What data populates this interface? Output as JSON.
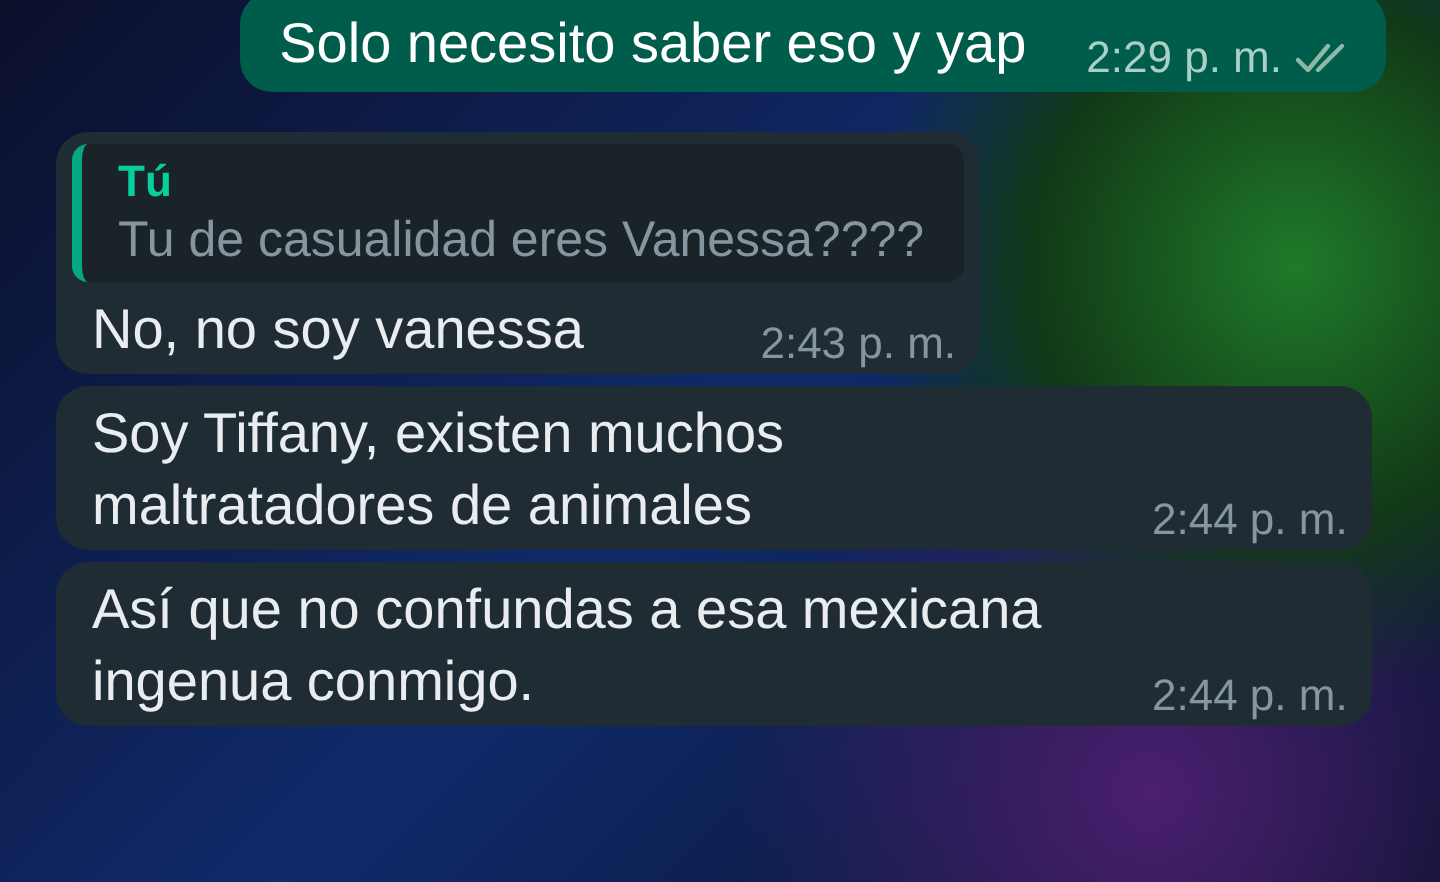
{
  "messages": [
    {
      "kind": "outgoing",
      "text": "Solo necesito saber eso y yap",
      "time": "2:29 p. m.",
      "read": false
    },
    {
      "kind": "incoming",
      "quote": {
        "author": "Tú",
        "text": "Tu de casualidad eres Vanessa????"
      },
      "text": "No, no soy vanessa",
      "time": "2:43 p. m."
    },
    {
      "kind": "incoming",
      "text": "Soy Tiffany, existen muchos maltratadores de animales",
      "time": "2:44 p. m."
    },
    {
      "kind": "incoming",
      "text": "Así que no confundas a esa mexicana ingenua conmigo.",
      "time": "2:44 p. m."
    }
  ]
}
